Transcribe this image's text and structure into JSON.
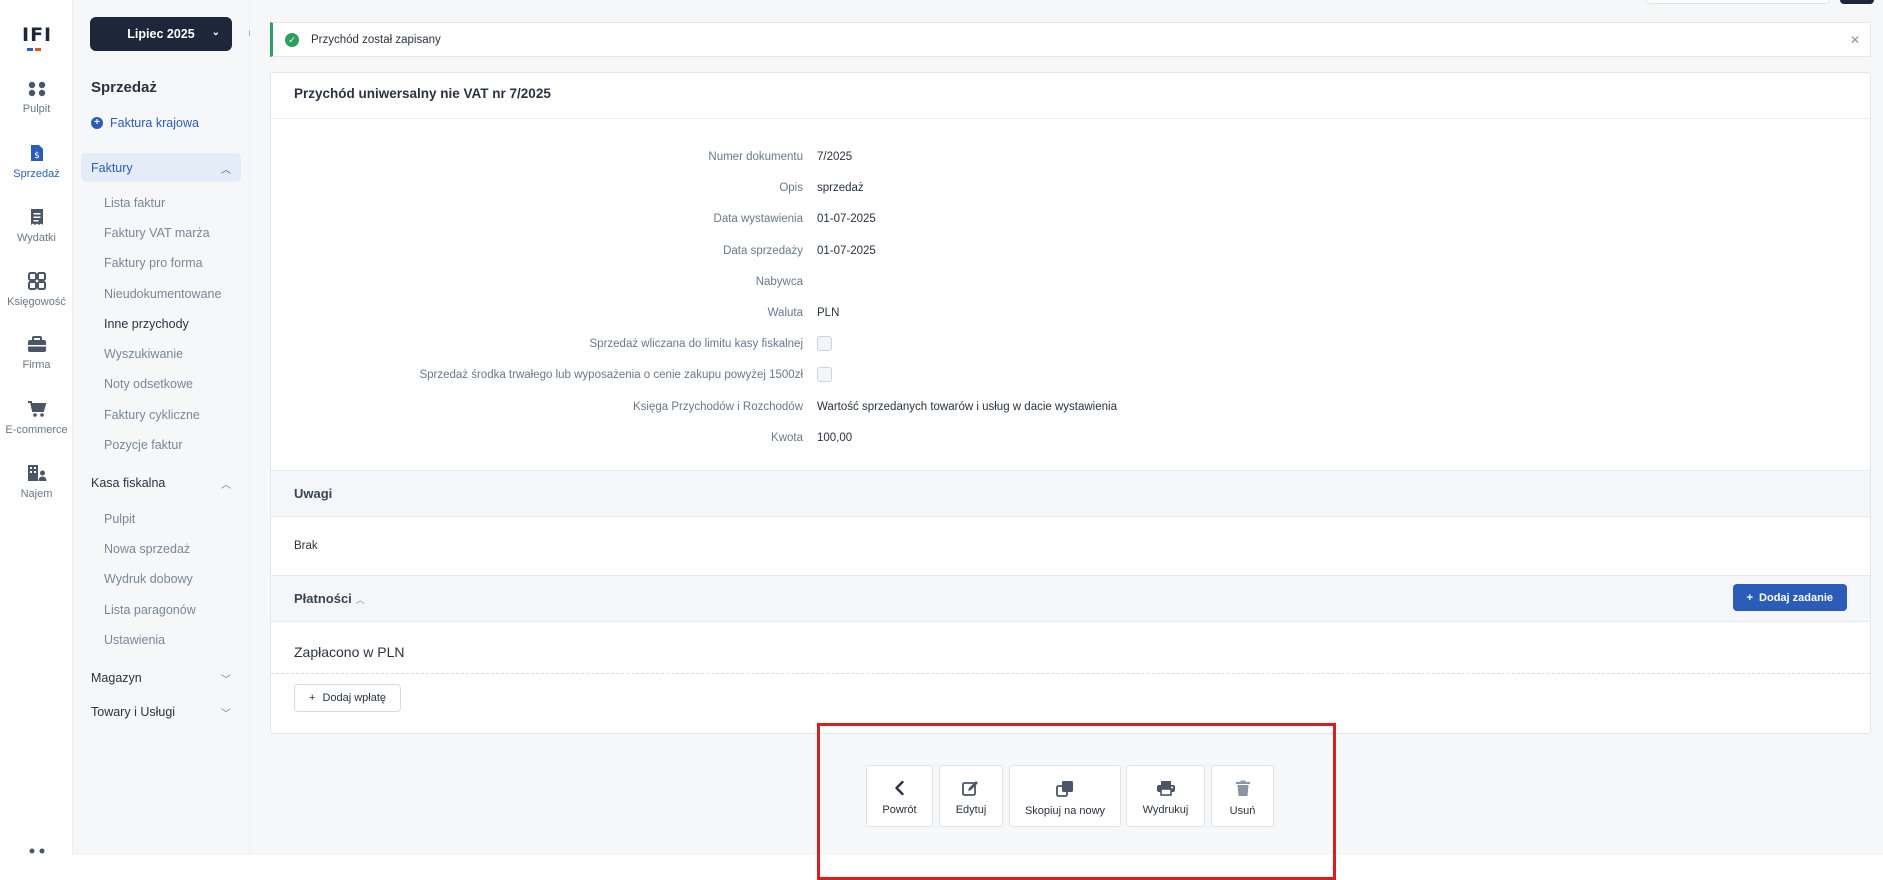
{
  "brand": {
    "logo_text": "IFI"
  },
  "rail": [
    {
      "id": "pulpit",
      "label": "Pulpit",
      "icon": "dots-grid-icon"
    },
    {
      "id": "sprzedaz",
      "label": "Sprzedaż",
      "icon": "invoice-dollar-icon"
    },
    {
      "id": "wydatki",
      "label": "Wydatki",
      "icon": "receipt-icon"
    },
    {
      "id": "ksiegowosc",
      "label": "Księgowość",
      "icon": "grid-four-icon"
    },
    {
      "id": "firma",
      "label": "Firma",
      "icon": "briefcase-icon"
    },
    {
      "id": "ecommerce",
      "label": "E-commerce",
      "icon": "cart-icon"
    },
    {
      "id": "najem",
      "label": "Najem",
      "icon": "building-person-icon"
    }
  ],
  "side": {
    "month": "Lipiec 2025",
    "title": "Sprzedaż",
    "add_invoice": "Faktura krajowa",
    "sections": {
      "faktury": "Faktury",
      "kasa": "Kasa fiskalna",
      "magazyn": "Magazyn",
      "towary": "Towary i Usługi"
    },
    "faktury_items": [
      "Lista faktur",
      "Faktury VAT marża",
      "Faktury pro forma",
      "Nieudokumentowane",
      "Inne przychody",
      "Wyszukiwanie",
      "Noty odsetkowe",
      "Faktury cykliczne",
      "Pozycje faktur"
    ],
    "kasa_items": [
      "Pulpit",
      "Nowa sprzedaż",
      "Wydruk dobowy",
      "Lista paragonów",
      "Ustawienia"
    ]
  },
  "toast": {
    "message": "Przychód został zapisany"
  },
  "document": {
    "title": "Przychód uniwersalny nie VAT nr 7/2025",
    "fields": [
      {
        "label": "Numer dokumentu",
        "value": "7/2025"
      },
      {
        "label": "Opis",
        "value": "sprzedaż"
      },
      {
        "label": "Data wystawienia",
        "value": "01-07-2025"
      },
      {
        "label": "Data sprzedaży",
        "value": "01-07-2025"
      },
      {
        "label": "Nabywca",
        "value": ""
      },
      {
        "label": "Waluta",
        "value": "PLN"
      },
      {
        "label": "Sprzedaż wliczana do limitu kasy fiskalnej",
        "checked": false
      },
      {
        "label": "Sprzedaż środka trwałego lub wyposażenia o cenie zakupu powyżej 1500zł",
        "checked": false
      },
      {
        "label": "Księga Przychodów i Rozchodów",
        "value": "Wartość sprzedanych towarów i usług  w dacie wystawienia"
      },
      {
        "label": "Kwota",
        "value": "100,00"
      }
    ]
  },
  "notes": {
    "title": "Uwagi",
    "value": "Brak"
  },
  "payments": {
    "title": "Płatności",
    "add_task": "Dodaj zadanie",
    "paid_title": "Zapłacono w PLN",
    "add_payment": "Dodaj wpłatę"
  },
  "actions": [
    {
      "label": "Powrót",
      "icon": "chevron-left-icon"
    },
    {
      "label": "Edytuj",
      "icon": "edit-icon"
    },
    {
      "label": "Skopiuj na nowy",
      "icon": "copy-icon"
    },
    {
      "label": "Wydrukuj",
      "icon": "printer-icon"
    },
    {
      "label": "Usuń",
      "icon": "trash-icon"
    }
  ],
  "colors": {
    "accent": "#2b5cb8",
    "dark": "#1e2639",
    "success": "#2f9e5e",
    "highlight": "#d71f1f"
  }
}
